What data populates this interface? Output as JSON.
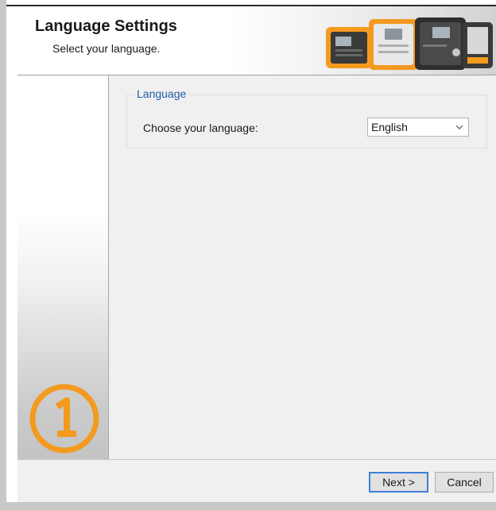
{
  "header": {
    "title": "Language Settings",
    "subtitle": "Select your language."
  },
  "sidebar": {
    "step_number": "1",
    "accent_color": "#f39a1f"
  },
  "language_group": {
    "legend": "Language",
    "label": "Choose your language:",
    "selected_language": "English",
    "legend_color": "#1f5ea8"
  },
  "footer": {
    "next_label": "Next >",
    "cancel_label": "Cancel"
  },
  "icons": {
    "dropdown": "chevron-down-icon",
    "header_graphic": "devices-illustration",
    "step": "step-number-badge"
  }
}
